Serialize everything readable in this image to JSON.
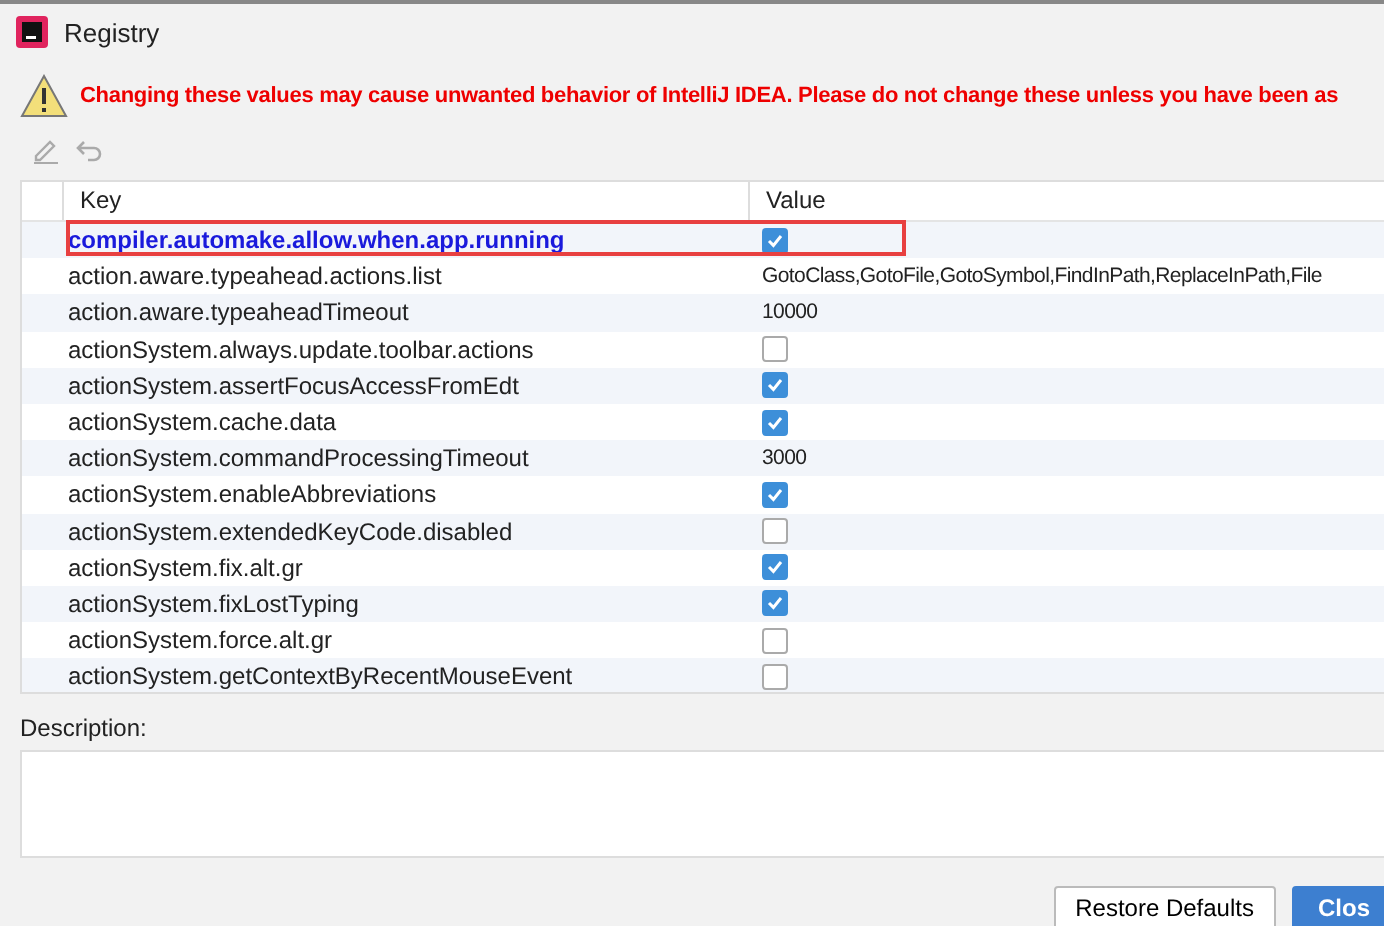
{
  "window": {
    "title": "Registry"
  },
  "warning": "Changing these values may cause unwanted behavior of IntelliJ IDEA. Please do not change these unless you have been as",
  "table": {
    "columns": [
      "Key",
      "Value"
    ],
    "rows": [
      {
        "key": "compiler.automake.allow.when.app.running",
        "kind": "checkbox",
        "checked": true,
        "modified": true,
        "highlighted": true
      },
      {
        "key": "action.aware.typeahead.actions.list",
        "kind": "text",
        "value": "GotoClass,GotoFile,GotoSymbol,FindInPath,ReplaceInPath,File",
        "modified": false,
        "highlighted": false
      },
      {
        "key": "action.aware.typeaheadTimeout",
        "kind": "text",
        "value": "10000",
        "modified": false,
        "highlighted": false
      },
      {
        "key": "actionSystem.always.update.toolbar.actions",
        "kind": "checkbox",
        "checked": false,
        "modified": false,
        "highlighted": false
      },
      {
        "key": "actionSystem.assertFocusAccessFromEdt",
        "kind": "checkbox",
        "checked": true,
        "modified": false,
        "highlighted": false
      },
      {
        "key": "actionSystem.cache.data",
        "kind": "checkbox",
        "checked": true,
        "modified": false,
        "highlighted": false
      },
      {
        "key": "actionSystem.commandProcessingTimeout",
        "kind": "text",
        "value": "3000",
        "modified": false,
        "highlighted": false
      },
      {
        "key": "actionSystem.enableAbbreviations",
        "kind": "checkbox",
        "checked": true,
        "modified": false,
        "highlighted": false
      },
      {
        "key": "actionSystem.extendedKeyCode.disabled",
        "kind": "checkbox",
        "checked": false,
        "modified": false,
        "highlighted": false
      },
      {
        "key": "actionSystem.fix.alt.gr",
        "kind": "checkbox",
        "checked": true,
        "modified": false,
        "highlighted": false
      },
      {
        "key": "actionSystem.fixLostTyping",
        "kind": "checkbox",
        "checked": true,
        "modified": false,
        "highlighted": false
      },
      {
        "key": "actionSystem.force.alt.gr",
        "kind": "checkbox",
        "checked": false,
        "modified": false,
        "highlighted": false
      },
      {
        "key": "actionSystem.getContextByRecentMouseEvent",
        "kind": "checkbox",
        "checked": false,
        "modified": false,
        "highlighted": false
      }
    ]
  },
  "description": {
    "label": "Description:"
  },
  "buttons": [
    {
      "label": "Restore Defaults",
      "kind": "secondary"
    },
    {
      "label": "Clos",
      "kind": "primary"
    }
  ]
}
